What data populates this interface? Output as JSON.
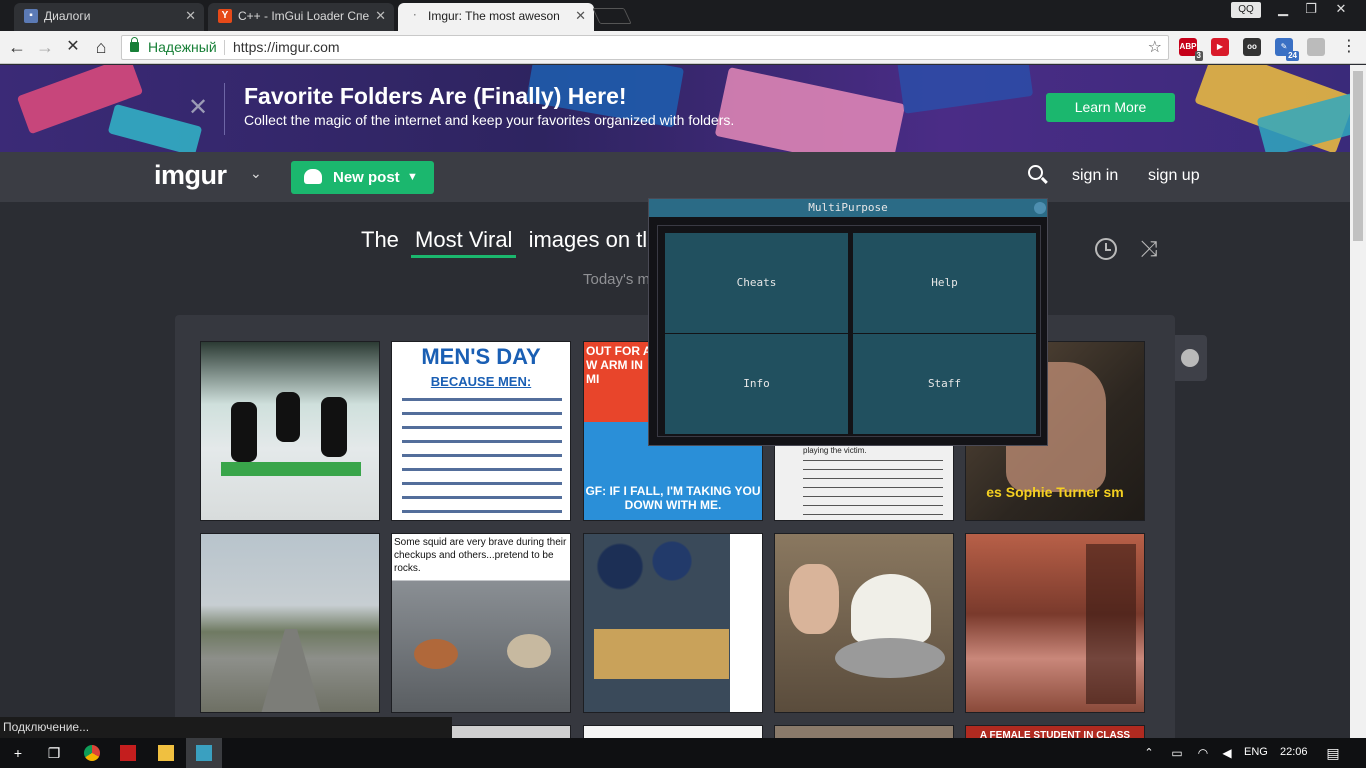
{
  "browser": {
    "tabs": [
      {
        "title": "Диалоги",
        "favicon_color": "#5b7ab5",
        "favicon_glyph": ""
      },
      {
        "title": "C++ - ImGui Loader Спе",
        "favicon_color": "#e64a19",
        "favicon_glyph": "Y"
      },
      {
        "title": "Imgur: The most aweson",
        "favicon_color": "#888888",
        "favicon_glyph": ""
      }
    ],
    "profile_label": "QQ",
    "secure_label": "Надежный",
    "url": "https://imgur.com",
    "extensions": [
      {
        "name": "abp-icon",
        "label": "ABP",
        "badge": "3",
        "color": "#c6001a"
      },
      {
        "name": "video-ext-icon",
        "label": "",
        "badge": "",
        "color": "#d91a2a"
      },
      {
        "name": "eyes-ext-icon",
        "label": "",
        "badge": "",
        "color": "#333333"
      },
      {
        "name": "pen-ext-icon",
        "label": "",
        "badge": "24",
        "color": "#3a70c4"
      },
      {
        "name": "disabled-ext-icon",
        "label": "",
        "badge": "",
        "color": "#bbbbbb"
      }
    ]
  },
  "promo": {
    "title": "Favorite Folders Are (Finally) Here!",
    "subtitle": "Collect the magic of the internet and keep your favorites organized with folders.",
    "cta": "Learn More"
  },
  "header": {
    "logo": "imgur",
    "new_post": "New post",
    "sign_in": "sign in",
    "sign_up": "sign up"
  },
  "section": {
    "prefix": "The",
    "sort": "Most Viral",
    "suffix": "images on tl",
    "subtitle": "Today's m"
  },
  "thumbnails": [
    {
      "bg": "#cfd8d6",
      "caption": "",
      "color": "#000000"
    },
    {
      "bg": "#ffffff",
      "caption": "MEN'S DAY",
      "color": "#1a5fb4"
    },
    {
      "bg": "#2a8fd8",
      "caption": "OUT FOR A W ARM IN MI",
      "color": "#ffffff"
    },
    {
      "bg": "#f0f0f0",
      "caption": "playing the victim.",
      "color": "#222222"
    },
    {
      "bg": "#2c2620",
      "caption": "es Sophie Turner sm",
      "color": "#f5d020"
    },
    {
      "bg": "#9aa2a0",
      "caption": "",
      "color": "#000000"
    },
    {
      "bg": "#8a8f94",
      "caption": "Some squid are very brave during their checkups and others...pretend to be rocks.",
      "color": "#111111"
    },
    {
      "bg": "#3a4a5a",
      "caption": "",
      "color": "#000000"
    },
    {
      "bg": "#6b5c48",
      "caption": "",
      "color": "#000000"
    },
    {
      "bg": "#7a3a2c",
      "caption": "",
      "color": "#000000"
    }
  ],
  "thumbnail_extra": {
    "mens_day_sub": "BECAUSE MEN:",
    "gf_caption": "GF: IF I FALL, I'M TAKING YOU DOWN WITH ME."
  },
  "bottom_row_caption": "A FEMALE STUDENT IN CLASS TODAY",
  "imgui": {
    "title": "MultiPurpose",
    "buttons": [
      "Cheats",
      "Help",
      "Info",
      "Staff"
    ]
  },
  "status_bubble": "Подключение...",
  "taskbar": {
    "lang": "ENG",
    "time": "22:06"
  }
}
